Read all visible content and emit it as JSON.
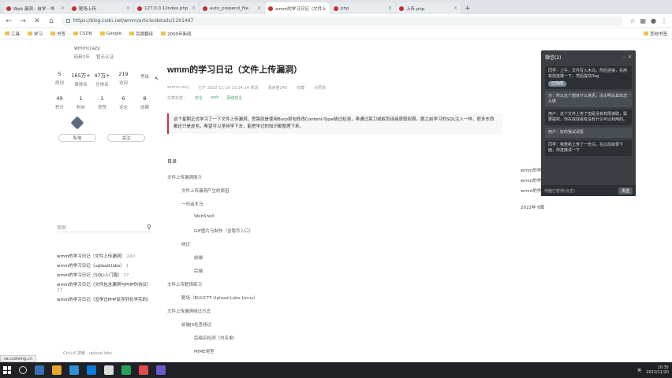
{
  "browser": {
    "tabs": [
      {
        "label": "Web 漏洞 - 自学 - 哔",
        "active": false
      },
      {
        "label": "靶场上传",
        "active": false
      },
      {
        "label": "127.0.0.1/index.php",
        "active": false
      },
      {
        "label": "auto_prepend_file",
        "active": false
      },
      {
        "label": "wmm的学习日记（文件上",
        "active": true
      },
      {
        "label": "php",
        "active": false
      },
      {
        "label": "上传.php",
        "active": false
      }
    ],
    "address": "https://blog.csdn.net/wmm/article/details/1291497",
    "bookmarks": [
      "工具",
      "学习",
      "书签",
      "CSDN",
      "Google",
      "百度翻译",
      "2000年新闻"
    ],
    "bookmarks_right": "其他书签"
  },
  "sidebar": {
    "username": "wmmcrazy",
    "meta": [
      "码龄2年",
      "暂无认证"
    ],
    "stats": [
      {
        "n": "5",
        "l": "原创"
      },
      {
        "n": "165万+",
        "l": "周排名"
      },
      {
        "n": "47万+",
        "l": "总排名"
      },
      {
        "n": "219",
        "l": "访问"
      },
      {
        "n": "",
        "l": "等级"
      },
      {
        "n": "49",
        "l": "积分"
      },
      {
        "n": "1",
        "l": "粉丝"
      },
      {
        "n": "1",
        "l": "获赞"
      },
      {
        "n": "6",
        "l": "评论"
      },
      {
        "n": "8",
        "l": "收藏"
      }
    ],
    "btn_private": "私信",
    "btn_follow": "关注",
    "search_placeholder": "搜索",
    "recent": [
      {
        "t": "wmm的学习日记（文件上传漏洞）",
        "c": "240"
      },
      {
        "t": "wmm的学习日记（upload-labs）",
        "c": "1"
      },
      {
        "t": "wmm的学习日记（SQLi入门篇）",
        "c": "37"
      },
      {
        "t": "wmm的学习日记（文件包含漏洞与PHP伪协议）",
        "c": "27"
      },
      {
        "t": "wmm的学习日记（没学过PHP反序列化学完的）",
        "c": ""
      }
    ]
  },
  "article": {
    "title": "wmm的学习日记（文件上传漏洞）",
    "meta": [
      "wmmcrazy",
      "已于 2022-11-20 11:34:14 修改",
      "阅读量240",
      "收藏",
      "点赞数"
    ],
    "tags_label": "文章标签：",
    "tags": [
      "安全",
      "web",
      "网络安全"
    ],
    "summary": "这个星期正式学习了一下文件上传漏洞，思路就是使用Burp抓包修改Content-Type绕过检测，再通过菜刀或蚁剑连接获取权限。跟之前学习的SQL注入一样，很多东西都还只是皮毛，希望可以坚持学下去，能把学过的知识都整理下来。"
  },
  "toc": {
    "head": "目录",
    "items": [
      {
        "t": "文件上传漏洞简介",
        "lv": 1
      },
      {
        "t": "文件上传漏洞产生的原因",
        "lv": 2
      },
      {
        "t": "一句话木马",
        "lv": 2
      },
      {
        "t": "WebShell",
        "lv": 3
      },
      {
        "t": "GIF图片马制作（含隐写入口）",
        "lv": 3
      },
      {
        "t": "绕过",
        "lv": 2
      },
      {
        "t": "前端",
        "lv": 3
      },
      {
        "t": "后端",
        "lv": 3
      },
      {
        "t": "文件上传靶场练习",
        "lv": 1
      },
      {
        "t": "靶场（BUUCTF Upload-Labs-Linux）",
        "lv": 2
      },
      {
        "t": "文件上传漏洞绕过方式",
        "lv": 1
      },
      {
        "t": "前端JS检查绕过",
        "lv": 2
      },
      {
        "t": "后缀名检测（白名单）",
        "lv": 3
      },
      {
        "t": "MIME类型",
        "lv": 3
      }
    ]
  },
  "right_col": {
    "items": [
      "wmm的学习日记（文件上传）",
      "wmm的学习日记（XSS漏洞学习总结篇）",
      "wmm的学习日记（SQLi入门篇）"
    ],
    "year": "2022年 6篇"
  },
  "chat": {
    "title": "微信(2)",
    "bubbles": [
      {
        "t": "同学：上午，文件写入木马，然后连接，先用蚁剑连接一下，然后提交flag",
        "style": "dark",
        "pill": "已完成"
      },
      {
        "t": "对：所以这个题目什么意思，没太明白具体怎么做",
        "style": "lite",
        "pill": ""
      },
      {
        "t": "用户：这个文件上传了但是没有权限读取，需要提权，你先找找看有没有什么可以利用的。",
        "style": "dark",
        "pill": ""
      },
      {
        "t": "用户：好的我试试看",
        "style": "lite",
        "pill": ""
      },
      {
        "t": "同学：我重新上传了一份马，在以前目录下面，你连接试一下",
        "style": "dark",
        "pill": ""
      }
    ],
    "input_placeholder": "电脑已暂停(点击)",
    "send": "发送"
  },
  "bottom_link": "Ctrl+K 搜索 · upload-labs",
  "status_url": "sa.csdnimg.cn",
  "taskbar": {
    "time": "10:35",
    "date": "2022/11/20",
    "tray": "英"
  },
  "colors": {
    "accent": "#c33333",
    "chat_bg": "#3b3f44",
    "taskbar_bg": "#1f2124"
  }
}
